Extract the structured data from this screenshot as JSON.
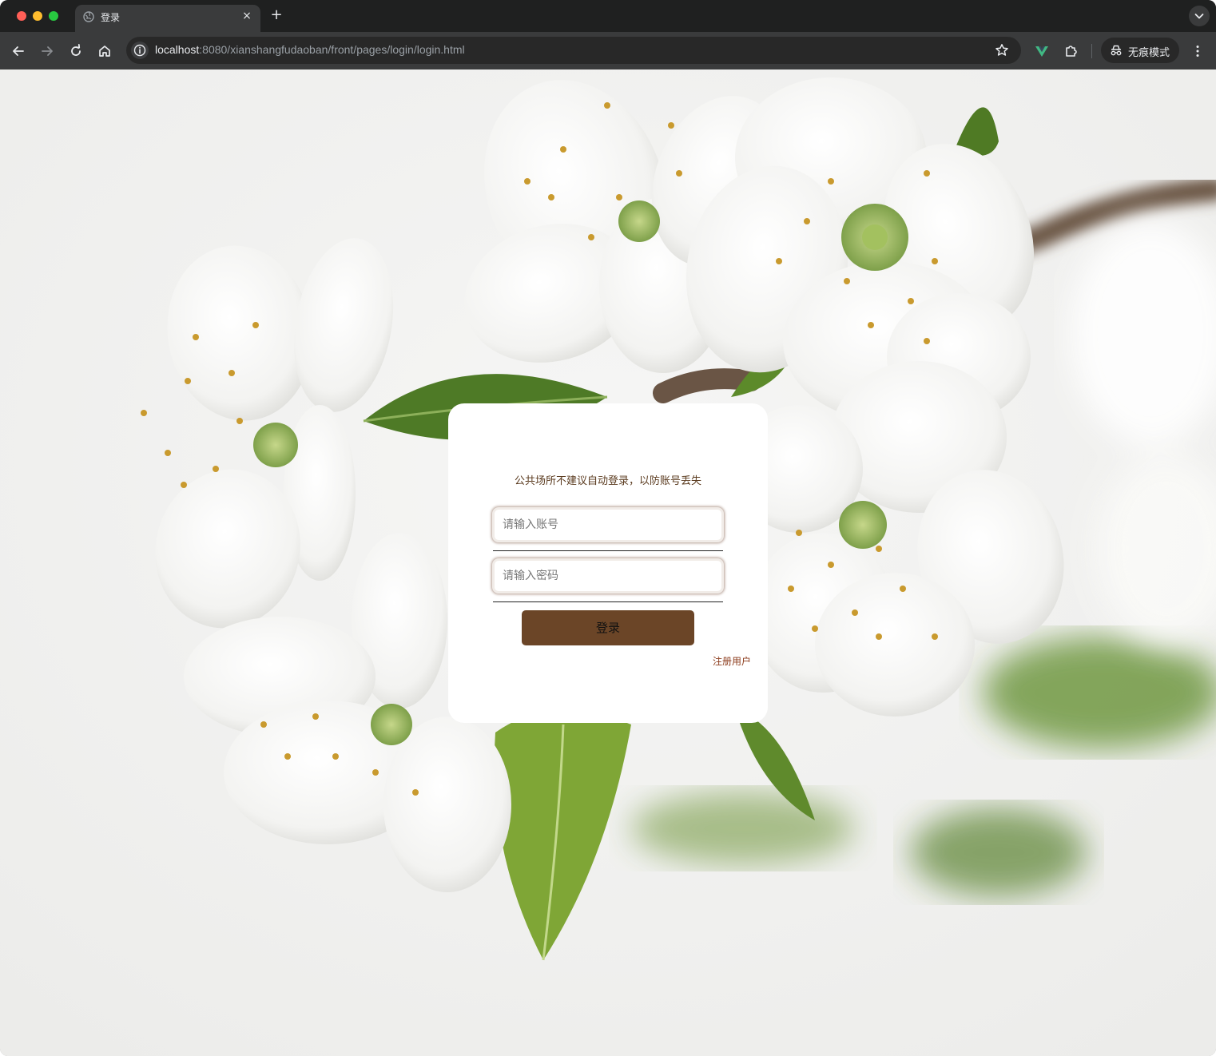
{
  "browser": {
    "tab": {
      "title": "登录",
      "close_symbol": "×"
    },
    "new_tab_symbol": "+",
    "address": {
      "host": "localhost",
      "path": ":8080/xianshangfudaoban/front/pages/login/login.html"
    },
    "incognito_label": "无痕模式"
  },
  "login": {
    "notice": "公共场所不建议自动登录，以防账号丢失",
    "username_placeholder": "请输入账号",
    "password_placeholder": "请输入密码",
    "submit_label": "登录",
    "register_label": "注册用户"
  },
  "colors": {
    "button_bg": "#6b4527",
    "notice_text": "#5a3a1e",
    "register_link": "#8b3a1a"
  }
}
